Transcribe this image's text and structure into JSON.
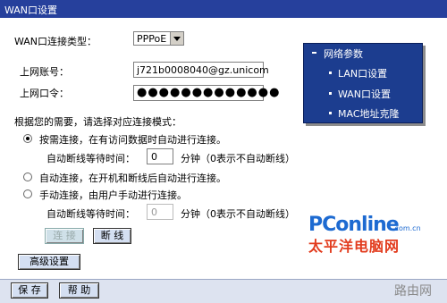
{
  "window": {
    "title": "WAN口设置"
  },
  "form": {
    "conn_type_label": "WAN口连接类型：",
    "conn_type_value": "PPPoE",
    "account_label": "上网账号：",
    "account_value": "j721b0008040@gz.unicom",
    "password_label": "上网口令：",
    "password_value": "●●●●●●●●●●●●●",
    "mode_prompt": "根据您的需要，请选择对应连接模式：",
    "options": [
      {
        "label": "按需连接，在有访问数据时自动进行连接。",
        "selected": true
      },
      {
        "label": "自动连接，在开机和断线后自动进行连接。",
        "selected": false
      },
      {
        "label": "手动连接，由用户手动进行连接。",
        "selected": false
      }
    ],
    "idle1_label": "自动断线等待时间：",
    "idle1_value": "0",
    "idle1_unit": "分钟（0表示不自动断线）",
    "idle2_label": "自动断线等待时间：",
    "idle2_value": "0",
    "idle2_unit": "分钟（0表示不自动断线）"
  },
  "buttons": {
    "connect": "连 接",
    "disconnect": "断 线",
    "advanced": "高级设置",
    "save": "保 存",
    "help": "帮 助"
  },
  "sidebar": {
    "header": "网络参数",
    "items": [
      "LAN口设置",
      "WAN口设置",
      "MAC地址克隆"
    ]
  },
  "watermark": {
    "logo_main": "PConline",
    "logo_domain": ".com.cn",
    "logo_cn": "太平洋电脑网",
    "site": "路由网"
  },
  "colors": {
    "titlebar": "#26409c",
    "sidebar": "#1c3d8f",
    "logo_blue": "#1d6ad1",
    "logo_red": "#e23b1d"
  }
}
